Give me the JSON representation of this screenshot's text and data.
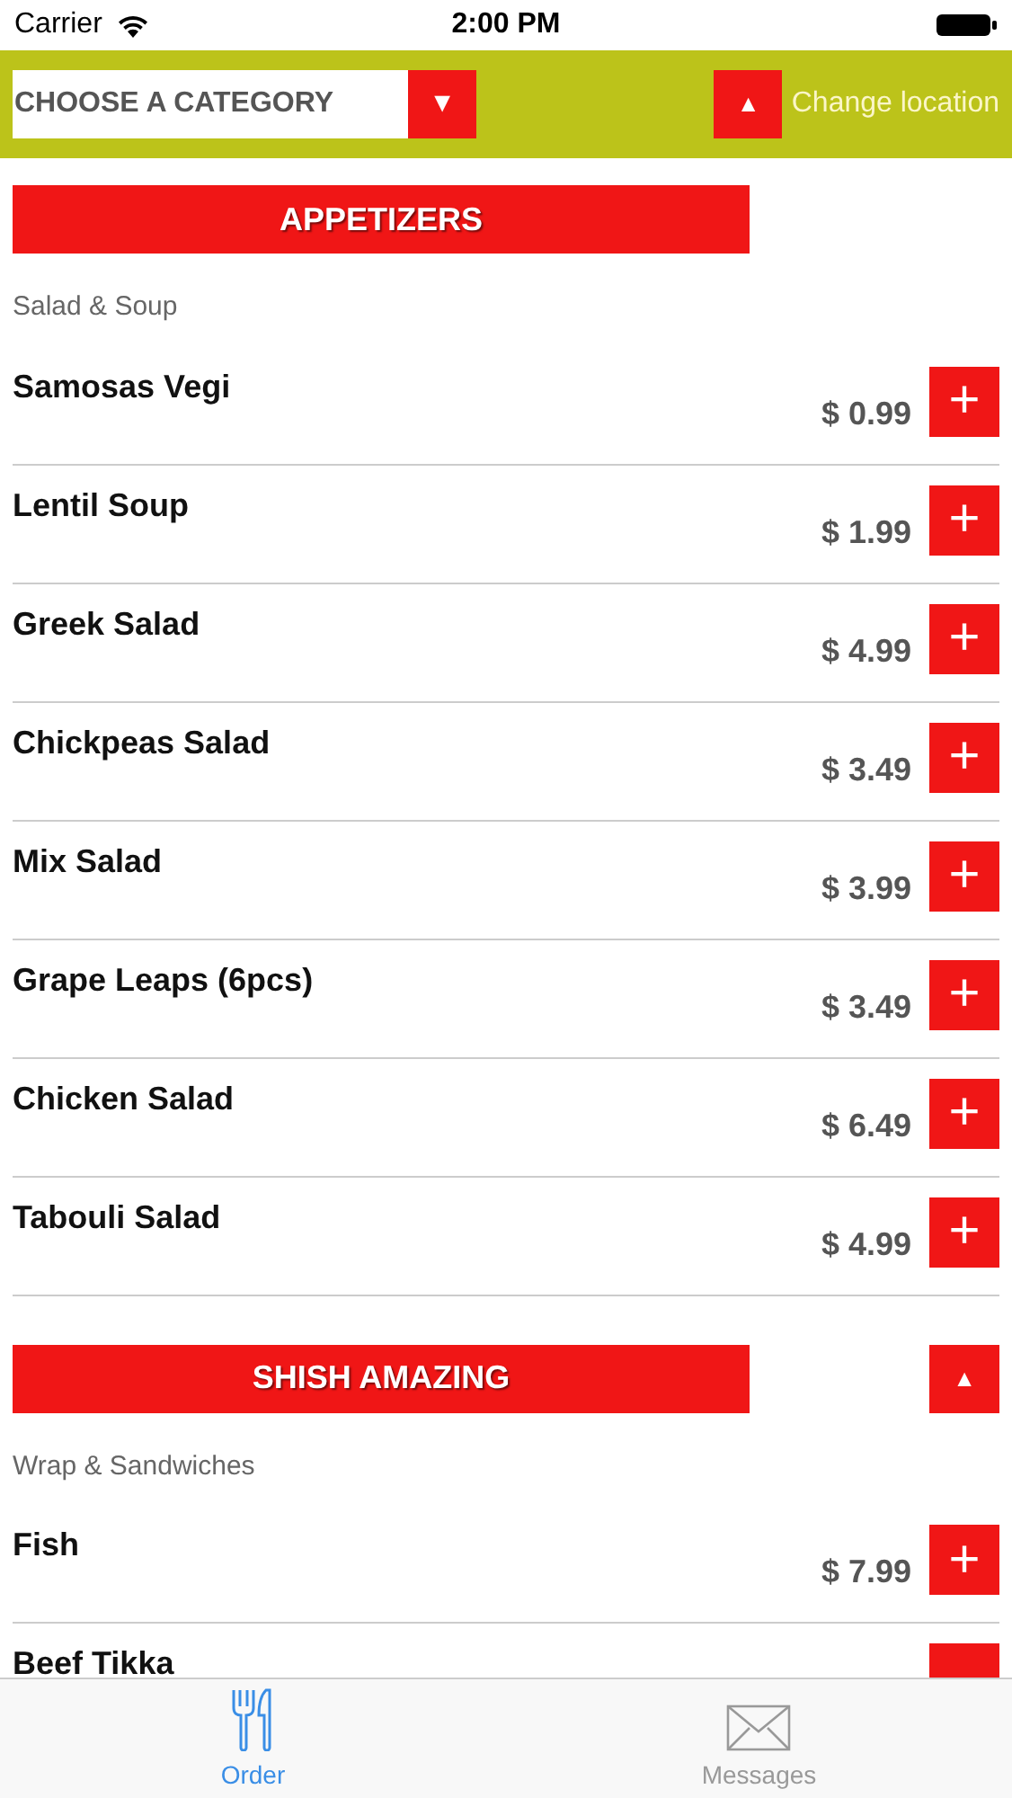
{
  "status_bar": {
    "carrier": "Carrier",
    "time": "2:00 PM"
  },
  "toolbar": {
    "category_placeholder": "CHOOSE A CATEGORY",
    "category_arrow": "▼",
    "location_arrow": "▲",
    "location_label": "Change location"
  },
  "sections": [
    {
      "title": "APPETIZERS",
      "subtitle": "Salad & Soup",
      "items": [
        {
          "name": "Samosas Vegi",
          "price": "$ 0.99",
          "add": "+"
        },
        {
          "name": "Lentil Soup",
          "price": "$ 1.99",
          "add": "+"
        },
        {
          "name": "Greek Salad",
          "price": "$ 4.99",
          "add": "+"
        },
        {
          "name": "Chickpeas Salad",
          "price": "$ 3.49",
          "add": "+"
        },
        {
          "name": "Mix Salad",
          "price": "$ 3.99",
          "add": "+"
        },
        {
          "name": "Grape Leaps (6pcs)",
          "price": "$ 3.49",
          "add": "+"
        },
        {
          "name": "Chicken Salad",
          "price": "$ 6.49",
          "add": "+"
        },
        {
          "name": "Tabouli Salad",
          "price": "$ 4.99",
          "add": "+"
        }
      ]
    },
    {
      "title": "SHISH AMAZING",
      "toggle": "▲",
      "subtitle": "Wrap & Sandwiches",
      "items": [
        {
          "name": "Fish",
          "price": "$ 7.99",
          "add": "+"
        },
        {
          "name": "Beef Tikka"
        }
      ]
    }
  ],
  "tabs": [
    {
      "kind": "order",
      "label": "Order",
      "selected": true
    },
    {
      "kind": "messages",
      "label": "Messages",
      "selected": false
    }
  ]
}
